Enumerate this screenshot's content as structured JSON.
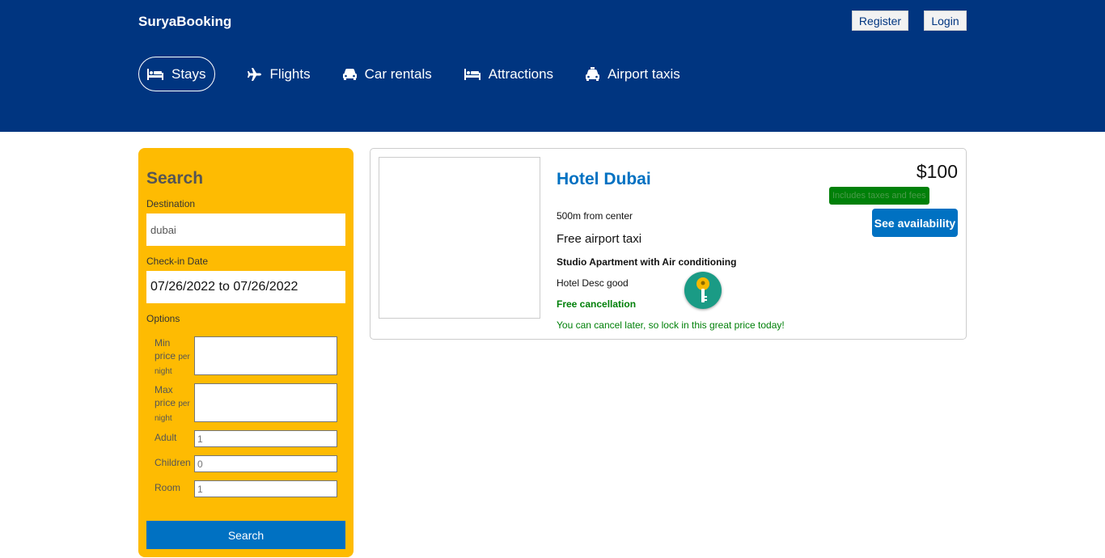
{
  "header": {
    "logo": "SuryaBooking",
    "register_label": "Register",
    "login_label": "Login"
  },
  "tabs": [
    {
      "label": "Stays",
      "icon": "bed-icon",
      "active": true
    },
    {
      "label": "Flights",
      "icon": "plane-icon",
      "active": false
    },
    {
      "label": "Car rentals",
      "icon": "car-icon",
      "active": false
    },
    {
      "label": "Attractions",
      "icon": "bed-icon",
      "active": false
    },
    {
      "label": "Airport taxis",
      "icon": "taxi-icon",
      "active": false
    }
  ],
  "search": {
    "title": "Search",
    "destination_label": "Destination",
    "destination_value": "dubai",
    "checkin_label": "Check-in Date",
    "checkin_value": "07/26/2022 to 07/26/2022",
    "options_label": "Options",
    "min_price_label": "Min price",
    "max_price_label": "Max price",
    "per_night": "per night",
    "adult_label": "Adult",
    "adult_value": "1",
    "children_label": "Children",
    "children_value": "0",
    "room_label": "Room",
    "room_value": "1",
    "search_button": "Search"
  },
  "result": {
    "hotel_name": "Hotel Dubai",
    "distance": "500m from center",
    "taxi": "Free airport taxi",
    "room_type": "Studio Apartment with Air conditioning",
    "description": "Hotel Desc good",
    "cancellation": "Free cancellation",
    "cancellation_sub": "You can cancel later, so lock in this great price today!",
    "price": "$100",
    "tax_note": "Includes taxes and fees",
    "availability_button": "See availability"
  },
  "colors": {
    "brand": "#003580",
    "accent_yellow": "#febb02",
    "button_blue": "#0071c2",
    "green": "#008009"
  }
}
